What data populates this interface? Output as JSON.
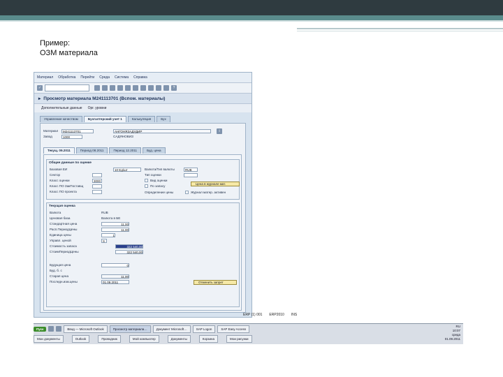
{
  "slide": {
    "line1": "Пример:",
    "line2": "ОЗМ материала"
  },
  "sap": {
    "menu": [
      "Материал",
      "Обработка",
      "Перейти",
      "Среда",
      "Система",
      "Справка"
    ],
    "title": "Просмотр материала M241113701 (Вспом. материалы)",
    "app_toolbar": [
      "Дополнительные данные",
      "Орг. уровни"
    ],
    "top_tabs": [
      "Управление качеством",
      "Бухгалтерский учет 1",
      "Калькуляция",
      "Бух"
    ],
    "header": {
      "material_label": "Материал",
      "material_value": "M241113701",
      "material_desc": "АНГОНЯЗАДУДИР",
      "plant_label": "Завод",
      "plant_value": "1000",
      "plant_desc": "САДЯНОВИЗ"
    },
    "period_tabs": [
      "Текущ.  09.2011",
      "Период  08.2011",
      "Период  12.2011",
      "Буд. цена"
    ],
    "general": {
      "title": "Общие данные по оценке",
      "labels": [
        "Базовая ЕИ",
        "Сектор",
        "Класс оценки",
        "Класс ПО ЗакПоставщ",
        "Класс ПО проекта"
      ],
      "values": [
        "10 Ед/шт",
        "",
        "3000",
        "",
        ""
      ],
      "right_labels": [
        "Валюта/Тип валюты",
        "Тип оценки",
        "Вид оценки",
        "По запасу",
        "Определение цены"
      ],
      "right_values": [
        "RUB",
        "",
        "",
        "",
        ""
      ],
      "ledger_button": "Цена в журнале мат.",
      "ml_active": "Журнал матер. активен"
    },
    "current": {
      "title": "Текущая оценка",
      "labels": [
        "Валюта",
        "Ценовая база",
        "Стандартная цена",
        "Расп.ПериодЦены",
        "Единица цены",
        "Управл. ценой",
        "Стоимость запаса",
        "СтоимПериодЦены"
      ],
      "values": [
        "RUB",
        "Валюта в БЕ",
        "11,00",
        "11,00",
        "1",
        "S",
        "322 540,00",
        "322 540,00"
      ]
    },
    "future": {
      "labels": [
        "Будущая цена",
        "Буд. б. с",
        "Старая цена",
        "Последн.изм.цены"
      ],
      "values": [
        "0",
        "",
        "11,00",
        "01.09.2011"
      ],
      "button": "Отменить запрет"
    },
    "status": [
      "ERP (1) 001",
      "ERP2010",
      "INS"
    ]
  },
  "taskbar": {
    "start": "Пуск",
    "row1": [
      "Ввод — Microsoft Outlook",
      "Просмотр материала…",
      "Документ Microsoft…",
      "SAP Logon",
      "SAP Easy Access"
    ],
    "row2": [
      "Мои документы",
      "Outlook",
      "Проводник",
      "Мой компьютер",
      "Документы",
      "Корзина",
      "Мои рисунки"
    ],
    "tray": [
      "RU",
      "10:07",
      "среда",
      "01.09.2011"
    ]
  }
}
